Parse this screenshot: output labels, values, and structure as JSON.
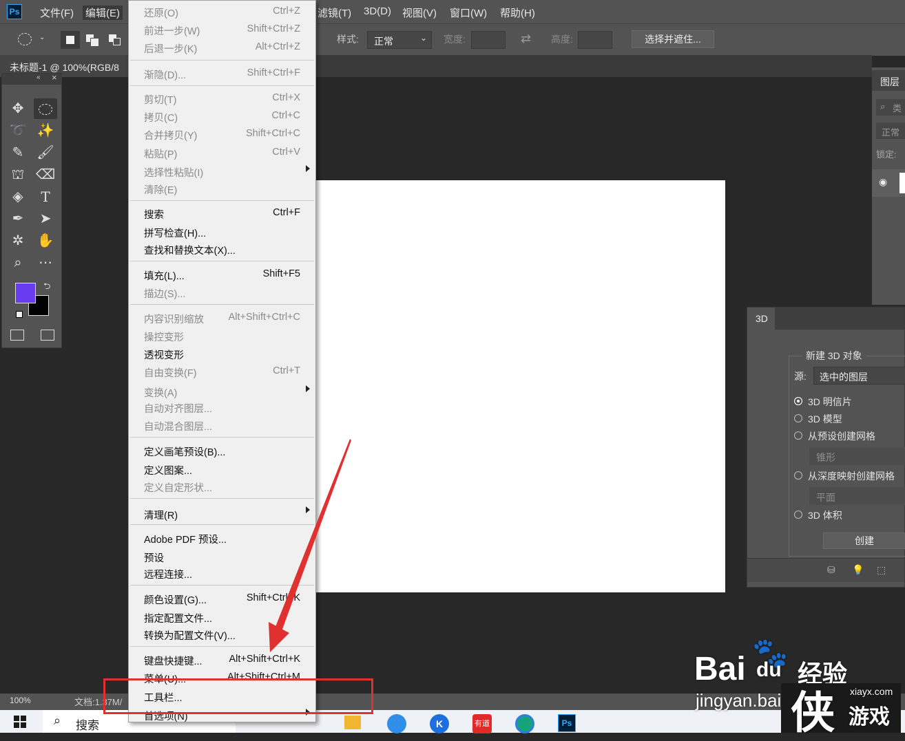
{
  "app": {
    "logo": "Ps"
  },
  "menubar": {
    "items": [
      "文件(F)",
      "编辑(E)",
      "滤镜(T)",
      "3D(D)",
      "视图(V)",
      "窗口(W)",
      "帮助(H)"
    ]
  },
  "options": {
    "style_label": "样式:",
    "style_value": "正常",
    "width_label": "宽度:",
    "height_label": "高度:",
    "select_mask_button": "选择并遮住..."
  },
  "document": {
    "tab_title": "未标题-1 @ 100%(RGB/8",
    "zoom": "100%",
    "doc_info": "文档:1.37M/"
  },
  "edit_menu": {
    "items": [
      {
        "label": "还原(O)",
        "shortcut": "Ctrl+Z",
        "enabled": false
      },
      {
        "label": "前进一步(W)",
        "shortcut": "Shift+Ctrl+Z",
        "enabled": false
      },
      {
        "label": "后退一步(K)",
        "shortcut": "Alt+Ctrl+Z",
        "enabled": false
      },
      {
        "label": "渐隐(D)...",
        "shortcut": "Shift+Ctrl+F",
        "enabled": false
      },
      {
        "label": "剪切(T)",
        "shortcut": "Ctrl+X",
        "enabled": false
      },
      {
        "label": "拷贝(C)",
        "shortcut": "Ctrl+C",
        "enabled": false
      },
      {
        "label": "合并拷贝(Y)",
        "shortcut": "Shift+Ctrl+C",
        "enabled": false
      },
      {
        "label": "粘贴(P)",
        "shortcut": "Ctrl+V",
        "enabled": false
      },
      {
        "label": "选择性粘贴(I)",
        "shortcut": "",
        "enabled": false
      },
      {
        "label": "清除(E)",
        "shortcut": "",
        "enabled": false
      },
      {
        "label": "搜索",
        "shortcut": "Ctrl+F",
        "enabled": true
      },
      {
        "label": "拼写检查(H)...",
        "shortcut": "",
        "enabled": true
      },
      {
        "label": "查找和替换文本(X)...",
        "shortcut": "",
        "enabled": true
      },
      {
        "label": "填充(L)...",
        "shortcut": "Shift+F5",
        "enabled": true
      },
      {
        "label": "描边(S)...",
        "shortcut": "",
        "enabled": false
      },
      {
        "label": "内容识别缩放",
        "shortcut": "Alt+Shift+Ctrl+C",
        "enabled": false
      },
      {
        "label": "操控变形",
        "shortcut": "",
        "enabled": false
      },
      {
        "label": "透视变形",
        "shortcut": "",
        "enabled": true
      },
      {
        "label": "自由变换(F)",
        "shortcut": "Ctrl+T",
        "enabled": false
      },
      {
        "label": "变换(A)",
        "shortcut": "",
        "enabled": false
      },
      {
        "label": "自动对齐图层...",
        "shortcut": "",
        "enabled": false
      },
      {
        "label": "自动混合图层...",
        "shortcut": "",
        "enabled": false
      },
      {
        "label": "定义画笔预设(B)...",
        "shortcut": "",
        "enabled": true
      },
      {
        "label": "定义图案...",
        "shortcut": "",
        "enabled": true
      },
      {
        "label": "定义自定形状...",
        "shortcut": "",
        "enabled": false
      },
      {
        "label": "清理(R)",
        "shortcut": "",
        "enabled": true
      },
      {
        "label": "Adobe PDF 预设...",
        "shortcut": "",
        "enabled": true
      },
      {
        "label": "预设",
        "shortcut": "",
        "enabled": true
      },
      {
        "label": "远程连接...",
        "shortcut": "",
        "enabled": true
      },
      {
        "label": "颜色设置(G)...",
        "shortcut": "Shift+Ctrl+K",
        "enabled": true
      },
      {
        "label": "指定配置文件...",
        "shortcut": "",
        "enabled": true
      },
      {
        "label": "转换为配置文件(V)...",
        "shortcut": "",
        "enabled": true
      },
      {
        "label": "键盘快捷键...",
        "shortcut": "Alt+Shift+Ctrl+K",
        "enabled": true
      },
      {
        "label": "菜单(U)...",
        "shortcut": "Alt+Shift+Ctrl+M",
        "enabled": true
      },
      {
        "label": "工具栏...",
        "shortcut": "",
        "enabled": true
      },
      {
        "label": "首选项(N)",
        "shortcut": "",
        "enabled": true
      }
    ]
  },
  "layers_panel": {
    "title": "图层",
    "search_hint": "类",
    "blend": "正常",
    "lock": "锁定:"
  },
  "panel_3d": {
    "tab": "3D",
    "group_title": "新建 3D 对象",
    "source_label": "源:",
    "source_value": "选中的图层",
    "options": [
      "3D 明信片",
      "3D 模型",
      "从预设创建网格",
      "从深度映射创建网格",
      "3D 体积"
    ],
    "preset_mesh": "锥形",
    "depth_mesh": "平面",
    "create_button": "创建"
  },
  "taskbar": {
    "search": "搜索",
    "youdao": "有道"
  },
  "watermark": {
    "brand": "Bai",
    "brand_du": "du",
    "brand_jingyan": "经验",
    "url": "jingyan.baidu.com",
    "site": "xiayx.com",
    "site_name": "游戏"
  },
  "colors": {
    "foreground": "#6a3cf0",
    "background": "#000000",
    "annotation": "#e03030"
  }
}
